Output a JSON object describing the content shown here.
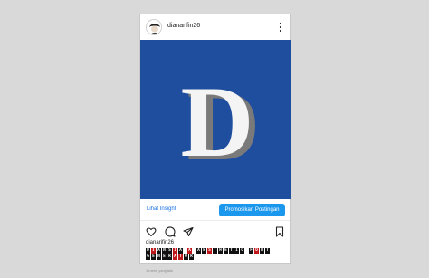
{
  "post": {
    "username": "dianarifin26",
    "photo_letter": "D",
    "colors": {
      "photo_bg": "#1f4e9e",
      "letter": "#f4f4f4",
      "letter_shadow": "#8d8d8d",
      "accent": "#1c97ee"
    }
  },
  "insights": {
    "link_label": "Lihat Insight",
    "promote_label": "Promosikan Postingan"
  },
  "actions": {
    "icons": [
      "heart-icon",
      "comment-icon",
      "share-icon",
      "bookmark-icon"
    ]
  },
  "caption": {
    "username": "dianarifin26",
    "lines": [
      [
        {
          "c": "D",
          "s": "dark"
        },
        {
          "c": "I",
          "s": "red"
        },
        {
          "c": "A",
          "s": "dark"
        },
        {
          "c": "N",
          "s": "dark"
        },
        {
          "c": "S",
          "s": "dark"
        },
        {
          "c": "I",
          "s": "red"
        },
        {
          "c": "A",
          "s": "dark"
        },
        {
          "c": " ",
          "s": "sp"
        },
        {
          "c": "A",
          "s": "red"
        },
        {
          "c": " ",
          "s": "sp"
        },
        {
          "c": "A",
          "s": "dark"
        },
        {
          "c": "E",
          "s": "dark"
        },
        {
          "c": "S",
          "s": "red"
        },
        {
          "c": "T",
          "s": "dark"
        },
        {
          "c": "H",
          "s": "dark"
        },
        {
          "c": "E",
          "s": "dark"
        },
        {
          "c": "T",
          "s": "dark"
        },
        {
          "c": "I",
          "s": "dark"
        },
        {
          "c": "C",
          "s": "dark"
        },
        {
          "c": " ",
          "s": "sp"
        },
        {
          "c": "F",
          "s": "dark"
        },
        {
          "c": "O",
          "s": "red"
        },
        {
          "c": "N",
          "s": "dark"
        },
        {
          "c": "T",
          "s": "dark"
        }
      ],
      [
        {
          "c": "G",
          "s": "dark"
        },
        {
          "c": "E",
          "s": "dark"
        },
        {
          "c": "N",
          "s": "dark"
        },
        {
          "c": "E",
          "s": "dark"
        },
        {
          "c": "R",
          "s": "dark"
        },
        {
          "c": "A",
          "s": "red"
        },
        {
          "c": "T",
          "s": "red"
        },
        {
          "c": "O",
          "s": "dark"
        },
        {
          "c": "R",
          "s": "dark"
        }
      ]
    ],
    "timestamp": "1 menit yang lalu"
  }
}
